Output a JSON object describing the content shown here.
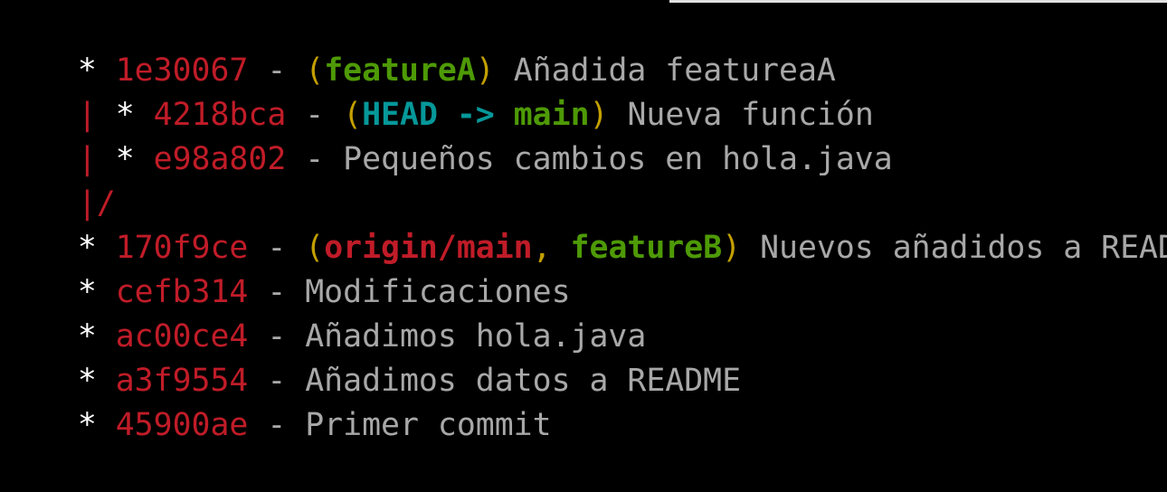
{
  "terminal": {
    "lines": [
      {
        "graph": "* ",
        "hash": "1e30067",
        "sep": " - ",
        "refs": [
          {
            "text": "featureA",
            "kind": "branch"
          }
        ],
        "message": "Añadida featureaA"
      },
      {
        "graph_bar": "|",
        "graph": " * ",
        "hash": "4218bca",
        "sep": " - ",
        "refs": [
          {
            "text": "HEAD",
            "kind": "head"
          },
          {
            "text": "main",
            "kind": "branch"
          }
        ],
        "message": "Nueva función"
      },
      {
        "graph_bar": "|",
        "graph": " * ",
        "hash": "e98a802",
        "sep": " - ",
        "message": "Pequeños cambios en hola.java"
      },
      {
        "graph_merge": "|/"
      },
      {
        "graph": "* ",
        "hash": "170f9ce",
        "sep": " - ",
        "refs": [
          {
            "text": "origin/main",
            "kind": "remote"
          },
          {
            "text": "featureB",
            "kind": "branch"
          }
        ],
        "message": "Nuevos añadidos a README"
      },
      {
        "graph": "* ",
        "hash": "cefb314",
        "sep": " - ",
        "message": "Modificaciones"
      },
      {
        "graph": "* ",
        "hash": "ac00ce4",
        "sep": " - ",
        "message": "Añadimos hola.java"
      },
      {
        "graph": "* ",
        "hash": "a3f9554",
        "sep": " - ",
        "message": "Añadimos datos a README"
      },
      {
        "graph": "* ",
        "hash": "45900ae",
        "sep": " - ",
        "message": "Primer commit"
      }
    ],
    "symbols": {
      "paren_open": "(",
      "paren_close": ")",
      "comma": ", ",
      "head_arrow": " -> "
    }
  },
  "colors": {
    "background": "#000000",
    "hash": "#c01c28",
    "text": "#a8a8a8",
    "paren": "#c4a000",
    "branch": "#4e9a06",
    "head": "#06989a",
    "remote": "#c01c28"
  }
}
